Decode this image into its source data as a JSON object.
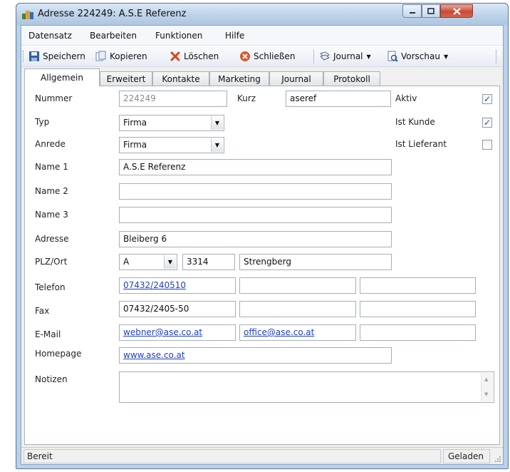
{
  "window": {
    "title": "Adresse 224249: A.S.E  Referenz",
    "minimize_icon": "minimize-icon",
    "maximize_icon": "maximize-icon",
    "close_icon": "close-icon"
  },
  "menu": [
    "Datensatz",
    "Bearbeiten",
    "Funktionen",
    "Hilfe"
  ],
  "toolbar": {
    "save": "Speichern",
    "copy": "Kopieren",
    "delete": "Löschen",
    "close": "Schließen",
    "journal": "Journal",
    "preview": "Vorschau"
  },
  "tabs": [
    "Allgemein",
    "Erweitert",
    "Kontakte",
    "Marketing",
    "Journal",
    "Protokoll"
  ],
  "active_tab": "Allgemein",
  "form": {
    "nummer_label": "Nummer",
    "nummer": "224249",
    "kurz_label": "Kurz",
    "kurz": "aseref",
    "aktiv_label": "Aktiv",
    "aktiv": true,
    "typ_label": "Typ",
    "typ": "Firma",
    "ist_kunde_label": "Ist Kunde",
    "ist_kunde": true,
    "anrede_label": "Anrede",
    "anrede": "Firma",
    "ist_lieferant_label": "Ist Lieferant",
    "ist_lieferant": false,
    "name1_label": "Name 1",
    "name1": "A.S.E  Referenz",
    "name2_label": "Name 2",
    "name2": "",
    "name3_label": "Name 3",
    "name3": "",
    "adresse_label": "Adresse",
    "adresse": "Bleiberg 6",
    "plzort_label": "PLZ/Ort",
    "land": "A",
    "plz": "3314",
    "ort": "Strengberg",
    "telefon_label": "Telefon",
    "telefon": [
      "07432/240510",
      "",
      ""
    ],
    "fax_label": "Fax",
    "fax": [
      "07432/2405-50",
      "",
      ""
    ],
    "email_label": "E-Mail",
    "email": [
      "webner@ase.co.at",
      "office@ase.co.at",
      ""
    ],
    "homepage_label": "Homepage",
    "homepage": "www.ase.co.at",
    "notizen_label": "Notizen",
    "notizen": ""
  },
  "status": {
    "left": "Bereit",
    "right": "Geladen"
  },
  "colors": {
    "link": "#1f3fc9",
    "checkmark": "#2b4a9a",
    "delete_x": "#d8431e"
  }
}
